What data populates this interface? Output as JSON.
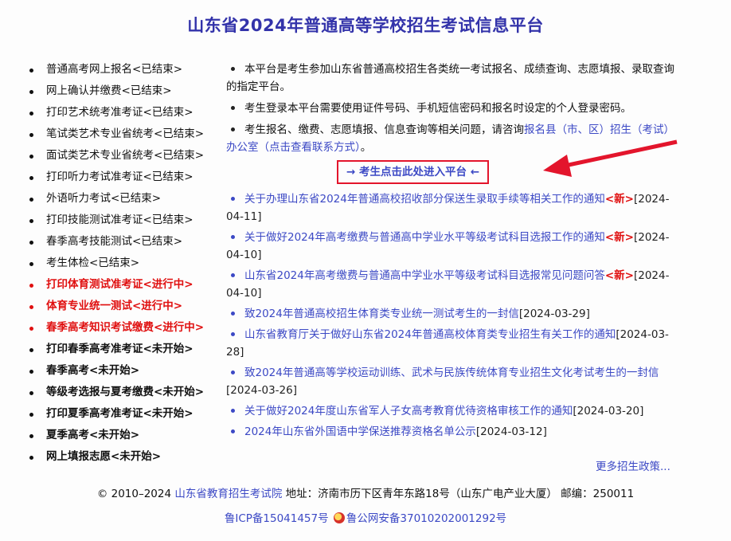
{
  "title": "山东省2024年普通高等学校招生考试信息平台",
  "left_menu": [
    {
      "label": "普通高考网上报名<已结束>",
      "status": "ended"
    },
    {
      "label": "网上确认并缴费<已结束>",
      "status": "ended"
    },
    {
      "label": "打印艺术统考准考证<已结束>",
      "status": "ended"
    },
    {
      "label": "笔试类艺术专业省统考<已结束>",
      "status": "ended"
    },
    {
      "label": "面试类艺术专业省统考<已结束>",
      "status": "ended"
    },
    {
      "label": "打印听力考试准考证<已结束>",
      "status": "ended"
    },
    {
      "label": "外语听力考试<已结束>",
      "status": "ended"
    },
    {
      "label": "打印技能测试准考证<已结束>",
      "status": "ended"
    },
    {
      "label": "春季高考技能测试<已结束>",
      "status": "ended"
    },
    {
      "label": "考生体检<已结束>",
      "status": "ended"
    },
    {
      "label": "打印体育测试准考证<进行中>",
      "status": "active"
    },
    {
      "label": "体育专业统一测试<进行中>",
      "status": "active"
    },
    {
      "label": "春季高考知识考试缴费<进行中>",
      "status": "active"
    },
    {
      "label": "打印春季高考准考证<未开始>",
      "status": "pending"
    },
    {
      "label": "春季高考<未开始>",
      "status": "pending"
    },
    {
      "label": "等级考选报与夏考缴费<未开始>",
      "status": "pending"
    },
    {
      "label": "打印夏季高考准考证<未开始>",
      "status": "pending"
    },
    {
      "label": "夏季高考<未开始>",
      "status": "pending"
    },
    {
      "label": "网上填报志愿<未开始>",
      "status": "pending"
    }
  ],
  "info": {
    "item1": "本平台是考生参加山东省普通高校招生各类统一考试报名、成绩查询、志愿填报、录取查询的指定平台。",
    "item2": "考生登录本平台需要使用证件号码、手机短信密码和报名时设定的个人登录密码。",
    "item3_prefix": "考生报名、缴费、志愿填报、信息查询等相关问题，请咨询",
    "item3_link": "报名县（市、区）招生（考试）办公室（点击查看联系方式）",
    "item3_suffix": "。"
  },
  "enter_button": "→ 考生点击此处进入平台 ←",
  "news": [
    {
      "title": "关于办理山东省2024年普通高校招收部分保送生录取手续等相关工作的通知",
      "new": "<新>",
      "date": "[2024-04-11]"
    },
    {
      "title": "关于做好2024年高考缴费与普通高中学业水平等级考试科目选报工作的通知",
      "new": "<新>",
      "date": "[2024-04-10]"
    },
    {
      "title": "山东省2024年高考缴费与普通高中学业水平等级考试科目选报常见问题问答",
      "new": "<新>",
      "date": "[2024-04-10]"
    },
    {
      "title": "致2024年普通高校招生体育类专业统一测试考生的一封信",
      "new": "",
      "date": "[2024-03-29]"
    },
    {
      "title": "山东省教育厅关于做好山东省2024年普通高校体育类专业招生有关工作的通知",
      "new": "",
      "date": "[2024-03-28]"
    },
    {
      "title": "致2024年普通高等学校运动训练、武术与民族传统体育专业招生文化考试考生的一封信",
      "new": "",
      "date": "[2024-03-26]"
    },
    {
      "title": "关于做好2024年度山东省军人子女高考教育优待资格审核工作的通知",
      "new": "",
      "date": "[2024-03-20]"
    },
    {
      "title": "2024年山东省外国语中学保送推荐资格名单公示",
      "new": "",
      "date": "[2024-03-12]"
    }
  ],
  "more_link": "更多招生政策...",
  "footer": {
    "copyright": "© 2010–2024",
    "org_link": "山东省教育招生考试院",
    "address": "地址：济南市历下区青年东路18号（山东广电产业大厦） 邮编：250011",
    "icp": "鲁ICP备15041457号",
    "police": "鲁公网安备37010202001292号"
  },
  "colors": {
    "title": "#3333aa",
    "link": "#3c49c5",
    "active": "#e01010",
    "highlight_border": "#e3152c"
  }
}
